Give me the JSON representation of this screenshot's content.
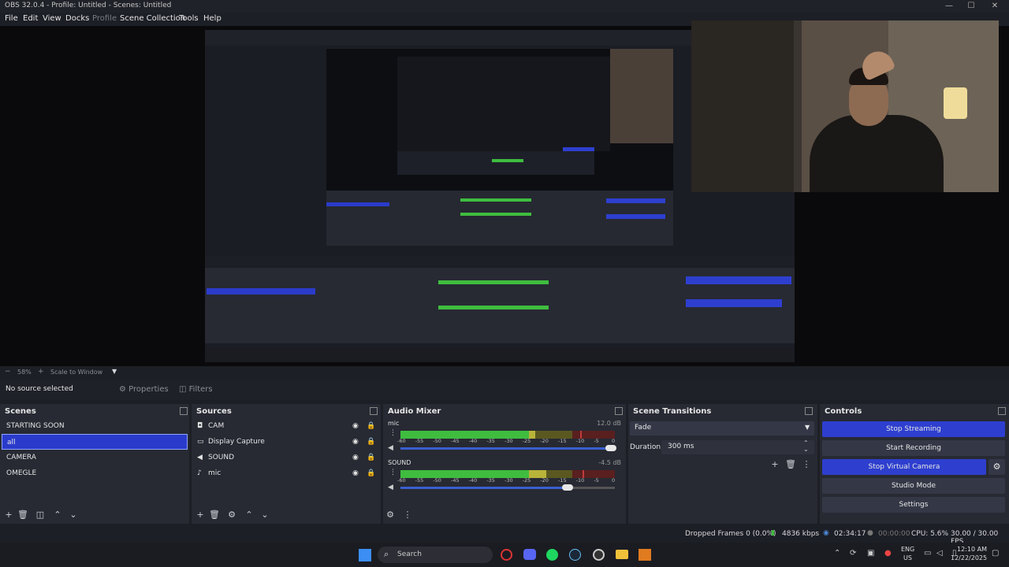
{
  "window": {
    "title": "OBS 32.0.4 - Profile: Untitled - Scenes: Untitled"
  },
  "menu": [
    "File",
    "Edit",
    "View",
    "Docks",
    "Profile",
    "Scene Collection",
    "Tools",
    "Help"
  ],
  "zoom": {
    "percent": "58%",
    "scale_label": "Scale to Window",
    "minus": "−",
    "plus": "+"
  },
  "source_toolbar": {
    "status": "No source selected",
    "properties": "Properties",
    "filters": "Filters"
  },
  "scenes": {
    "title": "Scenes",
    "items": [
      "STARTING SOON",
      "all",
      "CAMERA",
      "OMEGLE"
    ],
    "selected_index": 1
  },
  "sources": {
    "title": "Sources",
    "items": [
      {
        "name": "CAM",
        "icon": "camera-icon"
      },
      {
        "name": "Display Capture",
        "icon": "monitor-icon"
      },
      {
        "name": "SOUND",
        "icon": "speaker-icon"
      },
      {
        "name": "mic",
        "icon": "microphone-icon"
      }
    ]
  },
  "audio_mixer": {
    "title": "Audio Mixer",
    "channels": [
      {
        "name": "mic",
        "db": "12.0 dB",
        "level": 0.63,
        "peak": 0.84,
        "volume": 0.98
      },
      {
        "name": "SOUND",
        "db": "-4.5 dB",
        "level": 0.68,
        "peak": 0.85,
        "volume": 0.78
      }
    ],
    "ticks": [
      "-60",
      "-55",
      "-50",
      "-45",
      "-40",
      "-35",
      "-30",
      "-25",
      "-20",
      "-15",
      "-10",
      "-5",
      "0"
    ]
  },
  "transitions": {
    "title": "Scene Transitions",
    "type": "Fade",
    "duration_label": "Duration",
    "duration_value": "300 ms"
  },
  "controls": {
    "title": "Controls",
    "buttons": [
      {
        "label": "Stop Streaming",
        "active": true
      },
      {
        "label": "Start Recording",
        "active": false
      },
      {
        "label": "Stop Virtual Camera",
        "active": true
      },
      {
        "label": "Studio Mode",
        "active": false
      },
      {
        "label": "Settings",
        "active": false
      }
    ]
  },
  "status": {
    "dropped_frames": "Dropped Frames 0 (0.0%)",
    "bitrate": "4836 kbps",
    "stream_time": "02:34:17",
    "rec_time": "00:00:00",
    "cpu": "CPU: 5.6%",
    "fps": "30.00 / 30.00 FPS"
  },
  "taskbar": {
    "search_placeholder": "Search",
    "lang": "ENG",
    "region": "US",
    "time": "12:10 AM",
    "date": "12/22/2025"
  },
  "colors": {
    "accent": "#2e3fcf",
    "selection": "#2a3bcb",
    "meter_green": "#3fbd3f",
    "meter_yellow": "#b8b339",
    "meter_red": "#c33a3a"
  }
}
